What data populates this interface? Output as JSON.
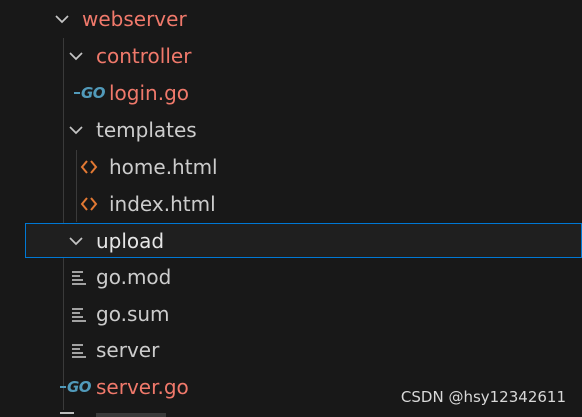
{
  "explorer": {
    "items": [
      {
        "label": "webserver",
        "type": "folder",
        "expanded": true,
        "icon": "chevron-down-icon",
        "color": "#f0796b"
      },
      {
        "label": "controller",
        "type": "folder",
        "expanded": true,
        "icon": "chevron-down-icon",
        "color": "#f0796b"
      },
      {
        "label": "login.go",
        "type": "file",
        "icon": "go-file-icon",
        "icon_text": "GO",
        "color": "#f0796b"
      },
      {
        "label": "templates",
        "type": "folder",
        "expanded": true,
        "icon": "chevron-down-icon"
      },
      {
        "label": "home.html",
        "type": "file",
        "icon": "html-code-icon"
      },
      {
        "label": "index.html",
        "type": "file",
        "icon": "html-code-icon"
      },
      {
        "label": "upload",
        "type": "folder",
        "expanded": true,
        "selected": true,
        "icon": "chevron-down-icon"
      },
      {
        "label": "go.mod",
        "type": "file",
        "icon": "text-lines-icon"
      },
      {
        "label": "go.sum",
        "type": "file",
        "icon": "text-lines-icon"
      },
      {
        "label": "server",
        "type": "file",
        "icon": "text-lines-icon"
      },
      {
        "label": "server.go",
        "type": "file",
        "icon": "go-file-icon",
        "icon_text": "GO",
        "color": "#f0796b"
      }
    ]
  },
  "watermark": "CSDN @hsy12342611",
  "colors": {
    "background": "#181818",
    "text": "#cccccc",
    "modified": "#f0796b",
    "go_icon": "#519aba",
    "html_icon": "#e37933",
    "selection_border": "#0078d4"
  }
}
